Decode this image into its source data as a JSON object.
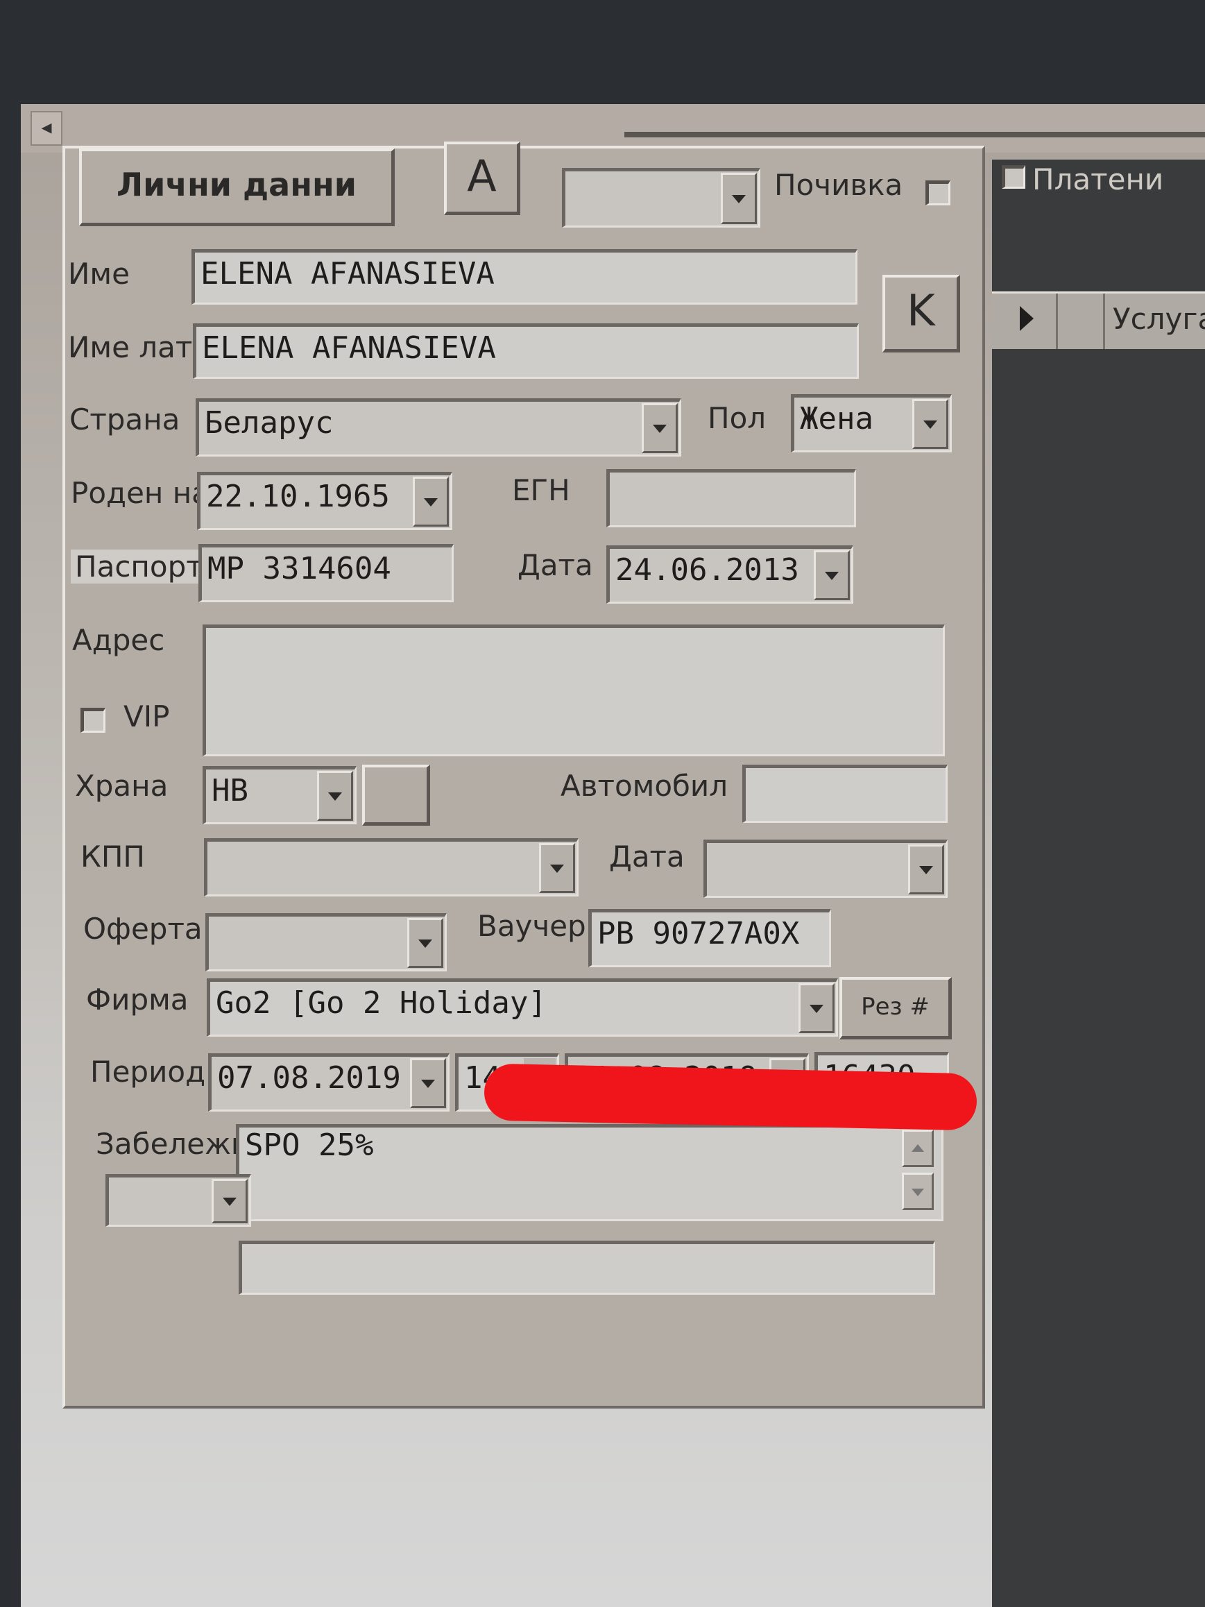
{
  "header": {
    "personal_data_button": "Лични данни",
    "a_button": "A",
    "k_button": "K",
    "rest_label": "Почивка",
    "paid_label": "Платени",
    "services_label": "Услуга"
  },
  "form": {
    "name": {
      "label": "Име",
      "value": "ELENA AFANASIEVA"
    },
    "name_lat": {
      "label": "Име лат",
      "value": "ELENA AFANASIEVA"
    },
    "country": {
      "label": "Страна",
      "value": "Беларус"
    },
    "gender": {
      "label": "Пол",
      "value": "Жена"
    },
    "birth_date": {
      "label": "Роден на",
      "value": "22.10.1965"
    },
    "egn": {
      "label": "ЕГН",
      "value": ""
    },
    "passport": {
      "label": "Паспорт",
      "value": "MP 3314604"
    },
    "passport_date": {
      "label": "Дата",
      "value": "24.06.2013"
    },
    "address": {
      "label": "Адрес",
      "value": ""
    },
    "vip": {
      "label": "VIP",
      "checked": false
    },
    "board": {
      "label": "Храна",
      "value": "HB"
    },
    "car": {
      "label": "Автомобил",
      "value": ""
    },
    "kpp": {
      "label": "КПП",
      "value": ""
    },
    "kpp_date": {
      "label": "Дата",
      "value": ""
    },
    "offer": {
      "label": "Оферта",
      "value": ""
    },
    "voucher": {
      "label": "Ваучер",
      "value": "PB 90727A0X"
    },
    "company": {
      "label": "Фирма",
      "value": "Go2 [Go 2 Holiday]",
      "button": "Рез #"
    },
    "period": {
      "label": "Период",
      "from": "07.08.2019",
      "nights": "14",
      "to": "21.08.2019",
      "reservation": "16430"
    },
    "note": {
      "label": "Забележка",
      "value": "SPO 25%"
    }
  },
  "colors": {
    "redaction": "#f0141b",
    "panel": "#b4ada6"
  }
}
